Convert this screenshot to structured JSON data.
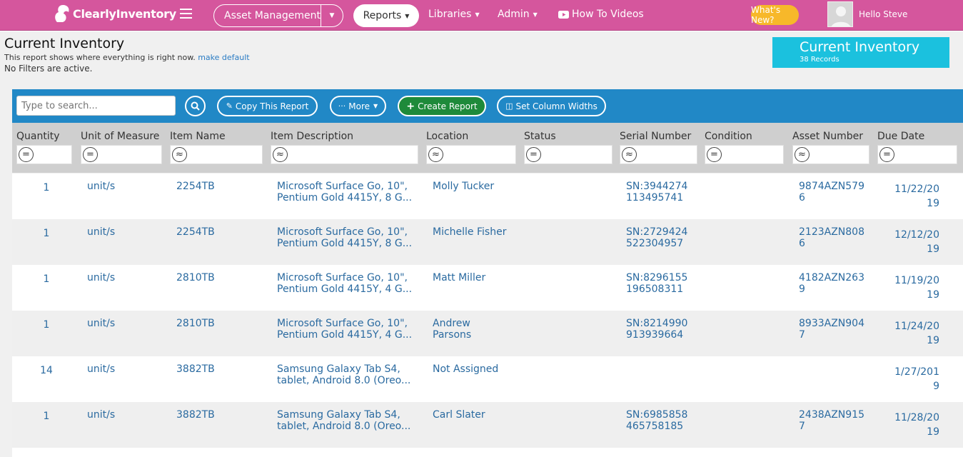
{
  "brand": {
    "logo_text": "ClearlyInventory"
  },
  "nav": {
    "asset_management": "Asset Management",
    "reports": "Reports",
    "libraries": "Libraries",
    "admin": "Admin",
    "how_to_videos": "How To Videos",
    "whats_new": "What's New?",
    "hello": "Hello Steve"
  },
  "page": {
    "title": "Current Inventory",
    "description": "This report shows where everything is right now.",
    "make_default": "make default",
    "filters": "No Filters are active.",
    "report_box_title": "Current Inventory",
    "report_box_count": "38 Records"
  },
  "toolbar": {
    "search_placeholder": "Type to search...",
    "copy_report": "Copy This Report",
    "more": "More",
    "create_report": "Create Report",
    "set_column_widths": "Set Column Widths"
  },
  "columns": [
    {
      "label": "Quantity",
      "filter": "="
    },
    {
      "label": "Unit of Measure",
      "filter": "="
    },
    {
      "label": "Item Name",
      "filter": "≈"
    },
    {
      "label": "Item Description",
      "filter": "≈"
    },
    {
      "label": "Location",
      "filter": "≈"
    },
    {
      "label": "Status",
      "filter": "="
    },
    {
      "label": "Serial Number",
      "filter": "≈"
    },
    {
      "label": "Condition",
      "filter": "="
    },
    {
      "label": "Asset Number",
      "filter": "≈"
    },
    {
      "label": "Due Date",
      "filter": "="
    }
  ],
  "rows": [
    {
      "qty": "1",
      "uom": "unit/s",
      "item": "2254TB",
      "desc1": "Microsoft Surface Go, 10\",",
      "desc2": "Pentium Gold 4415Y, 8 G...",
      "loc1": "Molly Tucker",
      "loc2": "",
      "serial1": "SN:3944274",
      "serial2": "113495741",
      "asset1": "9874AZN579",
      "asset2": "6",
      "due1": "11/22/20",
      "due2": "19"
    },
    {
      "qty": "1",
      "uom": "unit/s",
      "item": "2254TB",
      "desc1": "Microsoft Surface Go, 10\",",
      "desc2": "Pentium Gold 4415Y, 8 G...",
      "loc1": "Michelle Fisher",
      "loc2": "",
      "serial1": "SN:2729424",
      "serial2": "522304957",
      "asset1": "2123AZN808",
      "asset2": "6",
      "due1": "12/12/20",
      "due2": "19"
    },
    {
      "qty": "1",
      "uom": "unit/s",
      "item": "2810TB",
      "desc1": "Microsoft Surface Go, 10\",",
      "desc2": "Pentium Gold 4415Y, 4 G...",
      "loc1": "Matt Miller",
      "loc2": "",
      "serial1": "SN:8296155",
      "serial2": "196508311",
      "asset1": "4182AZN263",
      "asset2": "9",
      "due1": "11/19/20",
      "due2": "19"
    },
    {
      "qty": "1",
      "uom": "unit/s",
      "item": "2810TB",
      "desc1": "Microsoft Surface Go, 10\",",
      "desc2": "Pentium Gold 4415Y, 4 G...",
      "loc1": "Andrew",
      "loc2": "Parsons",
      "serial1": "SN:8214990",
      "serial2": "913939664",
      "asset1": "8933AZN904",
      "asset2": "7",
      "due1": "11/24/20",
      "due2": "19"
    },
    {
      "qty": "14",
      "uom": "unit/s",
      "item": "3882TB",
      "desc1": "Samsung Galaxy Tab S4,",
      "desc2": "tablet, Android 8.0 (Oreo...",
      "loc1": "Not Assigned",
      "loc2": "",
      "serial1": "",
      "serial2": "",
      "asset1": "",
      "asset2": "",
      "due1": "1/27/201",
      "due2": "9"
    },
    {
      "qty": "1",
      "uom": "unit/s",
      "item": "3882TB",
      "desc1": "Samsung Galaxy Tab S4,",
      "desc2": "tablet, Android 8.0 (Oreo...",
      "loc1": "Carl Slater",
      "loc2": "",
      "serial1": "SN:6985858",
      "serial2": "465758185",
      "asset1": "2438AZN915",
      "asset2": "7",
      "due1": "11/28/20",
      "due2": "19"
    }
  ],
  "colors": {
    "nav": "#d5569d",
    "toolbar": "#2188c6",
    "report_box": "#1bc1de",
    "create": "#1e8a3a",
    "whats_new": "#f7b82a"
  }
}
